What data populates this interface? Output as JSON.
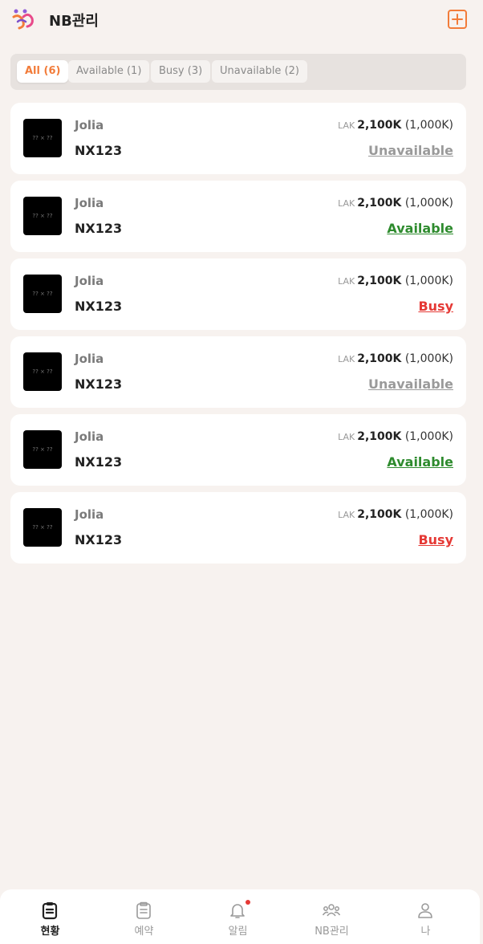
{
  "app": {
    "title": "NB관리"
  },
  "colors": {
    "accent": "#f27c3a",
    "available": "#2e8b2e",
    "busy": "#e53935",
    "unavailable": "#9a9a9a"
  },
  "filters": [
    {
      "label": "All (6)",
      "active": true
    },
    {
      "label": "Available (1)",
      "active": false
    },
    {
      "label": "Busy (3)",
      "active": false
    },
    {
      "label": "Unavailable (2)",
      "active": false
    }
  ],
  "cards": [
    {
      "thumb": "?? × ??",
      "name": "Jolia",
      "code": "NX123",
      "currency": "LAK",
      "amount": "2,100K",
      "sub": "(1,000K)",
      "status": "Unavailable",
      "status_key": "unavailable"
    },
    {
      "thumb": "?? × ??",
      "name": "Jolia",
      "code": "NX123",
      "currency": "LAK",
      "amount": "2,100K",
      "sub": "(1,000K)",
      "status": "Available",
      "status_key": "available"
    },
    {
      "thumb": "?? × ??",
      "name": "Jolia",
      "code": "NX123",
      "currency": "LAK",
      "amount": "2,100K",
      "sub": "(1,000K)",
      "status": "Busy",
      "status_key": "busy"
    },
    {
      "thumb": "?? × ??",
      "name": "Jolia",
      "code": "NX123",
      "currency": "LAK",
      "amount": "2,100K",
      "sub": "(1,000K)",
      "status": "Unavailable",
      "status_key": "unavailable"
    },
    {
      "thumb": "?? × ??",
      "name": "Jolia",
      "code": "NX123",
      "currency": "LAK",
      "amount": "2,100K",
      "sub": "(1,000K)",
      "status": "Available",
      "status_key": "available"
    },
    {
      "thumb": "?? × ??",
      "name": "Jolia",
      "code": "NX123",
      "currency": "LAK",
      "amount": "2,100K",
      "sub": "(1,000K)",
      "status": "Busy",
      "status_key": "busy"
    }
  ],
  "nav": [
    {
      "label": "현황",
      "icon": "clipboard-icon",
      "active": true
    },
    {
      "label": "예약",
      "icon": "document-icon",
      "active": false
    },
    {
      "label": "알림",
      "icon": "bell-icon",
      "active": false
    },
    {
      "label": "NB관리",
      "icon": "group-icon",
      "active": false
    },
    {
      "label": "나",
      "icon": "user-icon",
      "active": false
    }
  ]
}
